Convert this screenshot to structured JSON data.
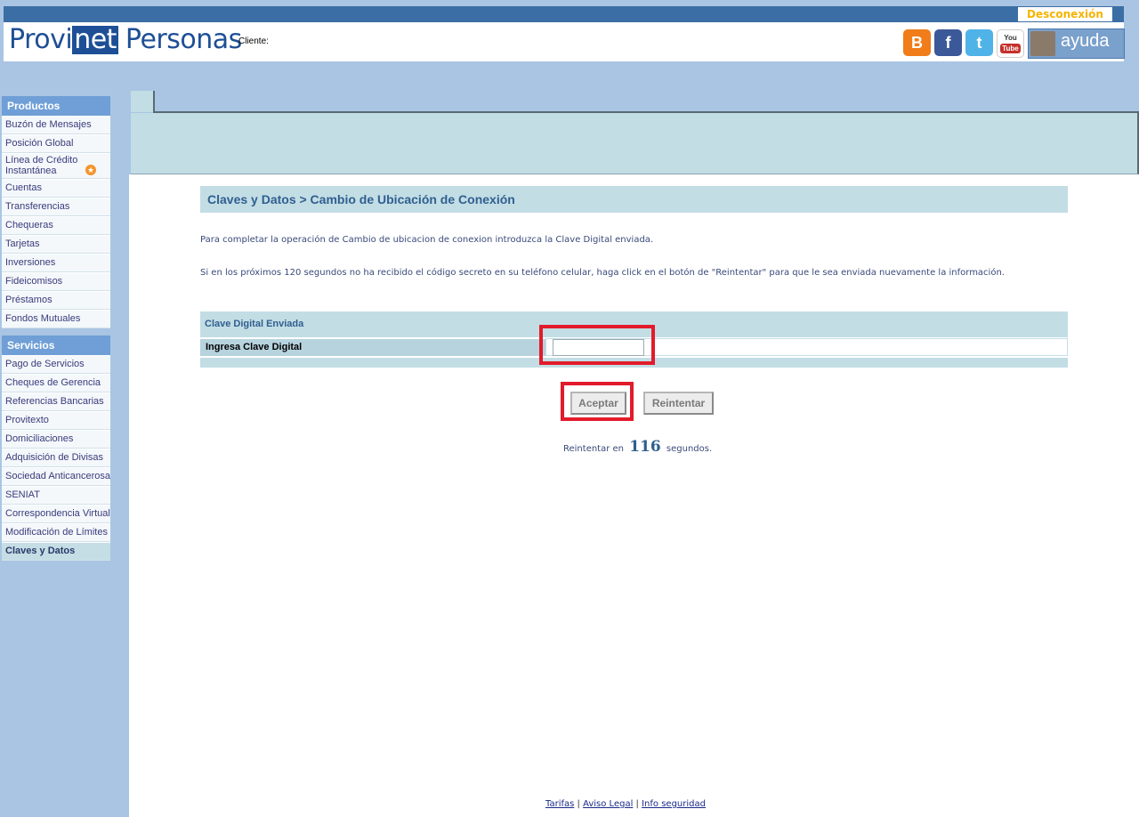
{
  "header": {
    "logout_label": "Desconexión",
    "logo_part1": "Provi",
    "logo_part2": "net",
    "logo_part3": "Personas",
    "client_label": "Cliente:",
    "help_label": "ayuda",
    "social": {
      "blog": "B",
      "facebook": "f",
      "twitter": "t",
      "youtube_top": "You",
      "youtube_bottom": "Tube"
    }
  },
  "sidebar": {
    "productos_title": "Productos",
    "productos": [
      "Buzón de Mensajes",
      "Posición Global",
      "Línea de Crédito Instantánea",
      "Cuentas",
      "Transferencias",
      "Chequeras",
      "Tarjetas",
      "Inversiones",
      "Fideicomisos",
      "Préstamos",
      "Fondos Mutuales"
    ],
    "servicios_title": "Servicios",
    "servicios": [
      "Pago de Servicios",
      "Cheques de Gerencia",
      "Referencias Bancarias",
      "Provitexto",
      "Domiciliaciones",
      "Adquisición de Divisas",
      "Sociedad Anticancerosa",
      "SENIAT",
      "Correspondencia Virtual",
      "Modificación de Límites",
      "Claves y Datos"
    ],
    "active": "Claves y Datos"
  },
  "main": {
    "title": "Claves y Datos > Cambio de Ubicación de Conexión",
    "instruction_1": "Para completar la operación de Cambio de ubicacion de conexion introduzca la Clave Digital enviada.",
    "instruction_2": "Si en los próximos 120 segundos no ha recibido el código secreto en su teléfono celular, haga click en el botón de \"Reintentar\" para que le sea enviada nuevamente la información.",
    "form": {
      "header": "Clave Digital Enviada",
      "label": "Ingresa Clave Digital",
      "value": ""
    },
    "buttons": {
      "accept": "Aceptar",
      "retry": "Reintentar"
    },
    "countdown": {
      "prefix": "Reintentar en",
      "seconds": "116",
      "suffix": "segundos."
    }
  },
  "footer": {
    "links": [
      "Tarifas",
      "Aviso Legal",
      "Info seguridad"
    ],
    "separator": "|"
  },
  "colors": {
    "accent": "#1e4f96",
    "highlight": "#e21b2b",
    "panel": "#c3dde5",
    "background": "#a9c5e3"
  }
}
